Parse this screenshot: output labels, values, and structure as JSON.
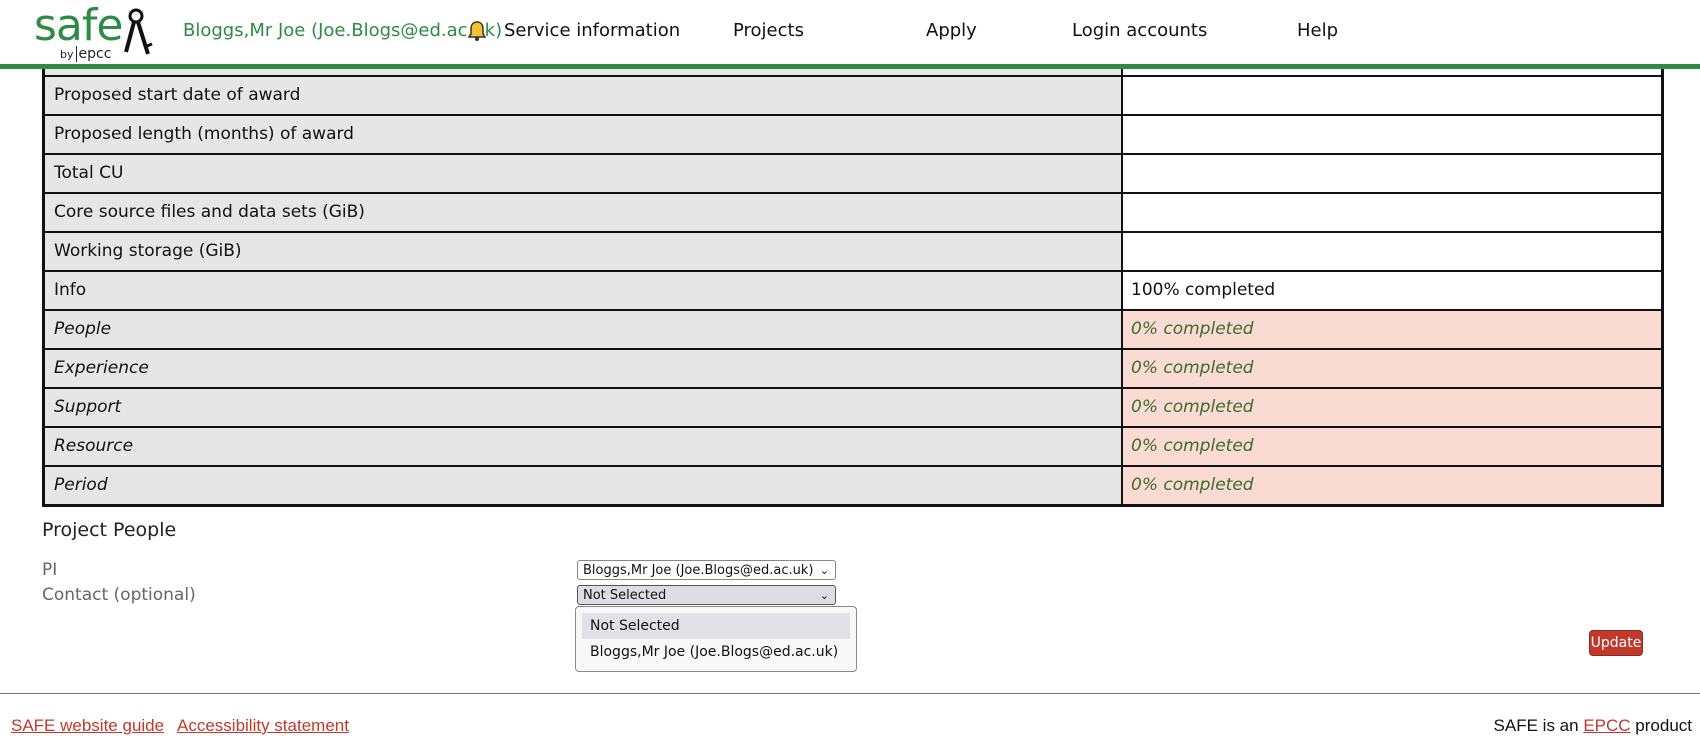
{
  "brand": {
    "logo_word": "safe",
    "logo_by": "by",
    "logo_org": "epcc"
  },
  "header": {
    "user": "Bloggs,Mr Joe (Joe.Blogs@ed.ac.uk)",
    "nav": [
      "Service information",
      "Projects",
      "Apply",
      "Login accounts",
      "Help"
    ]
  },
  "table": {
    "rows": [
      {
        "label": "Proposed start date of award",
        "value": ""
      },
      {
        "label": "Proposed length (months) of award",
        "value": ""
      },
      {
        "label": "Total CU",
        "value": ""
      },
      {
        "label": "Core source files and data sets (GiB)",
        "value": ""
      },
      {
        "label": "Working storage (GiB)",
        "value": ""
      },
      {
        "label": "Info",
        "value": "100% completed"
      },
      {
        "label": "People",
        "value": "0% completed"
      },
      {
        "label": "Experience",
        "value": "0% completed"
      },
      {
        "label": "Support",
        "value": "0% completed"
      },
      {
        "label": "Resource",
        "value": "0% completed"
      },
      {
        "label": "Period",
        "value": "0% completed"
      }
    ]
  },
  "people": {
    "title": "Project People",
    "pi_label": "PI",
    "pi_value": "Bloggs,Mr Joe (Joe.Blogs@ed.ac.uk)",
    "contact_label": "Contact (optional)",
    "contact_value": "Not Selected",
    "contact_options": [
      "Not Selected",
      "Bloggs,Mr Joe (Joe.Blogs@ed.ac.uk)"
    ],
    "update_label": "Update"
  },
  "footer": {
    "guide": "SAFE website guide",
    "accessibility": "Accessibility statement",
    "product_prefix": "SAFE is an",
    "product_link": "EPCC",
    "product_suffix": "product"
  },
  "colors": {
    "brand_green": "#2e8b45",
    "accent_red": "#c0392b",
    "incomplete_bg": "#fadbd2"
  }
}
